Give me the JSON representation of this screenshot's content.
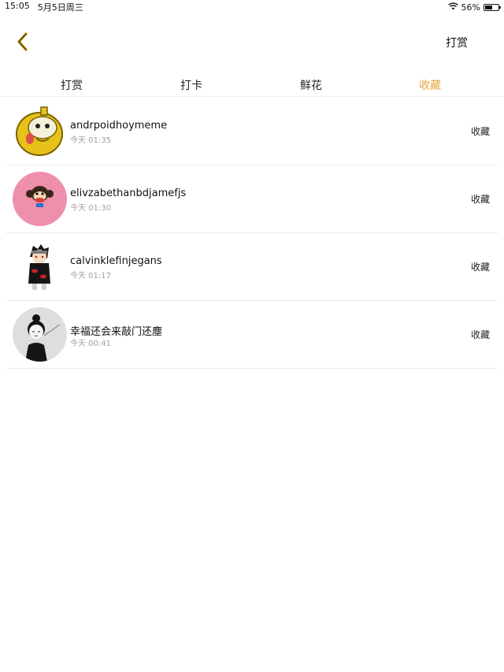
{
  "status_bar": {
    "time": "15:05",
    "date": "5月5日周三",
    "battery": "56%",
    "battery_level": 0.56
  },
  "nav": {
    "back_icon": "chevron-left-icon",
    "right_label": "打赏"
  },
  "tabs": [
    {
      "label": "打赏",
      "active": false
    },
    {
      "label": "打卡",
      "active": false
    },
    {
      "label": "鲜花",
      "active": false
    },
    {
      "label": "收藏",
      "active": true
    }
  ],
  "accent_color": "#e4a73a",
  "list": [
    {
      "name": "andrpoidhoymeme",
      "time": "今天 01:35",
      "action": "收藏",
      "avatar": "yellow-cartoon-avatar"
    },
    {
      "name": "elivzabethanbdjamefjs",
      "time": "今天 01:30",
      "action": "收藏",
      "avatar": "pink-monkey-avatar"
    },
    {
      "name": "calvinklefinjegans",
      "time": "今天 01:17",
      "action": "收藏",
      "avatar": "anime-ninja-avatar"
    },
    {
      "name": "幸福还会来敲门还塵",
      "time": "今天 00:41",
      "action": "收藏",
      "avatar": "sketch-girl-avatar"
    }
  ]
}
